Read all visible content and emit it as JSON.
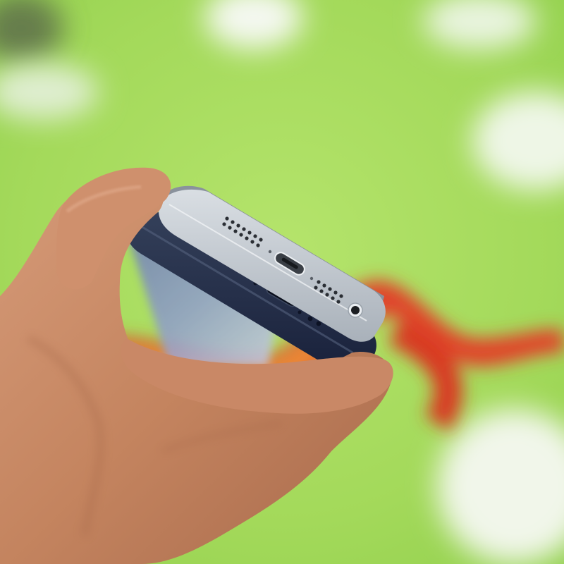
{
  "scene": {
    "subject": "two-phones-bottom-edges",
    "background": "blurred-green-backdrop",
    "colors": {
      "background_green": "#a6dc5a",
      "background_light": "#d8f0b0",
      "silver_phone": "#c9cfd6",
      "dark_phone": "#26324a",
      "skin": "#c98a6a",
      "accent_red": "#e0452a",
      "accent_orange": "#f2a03a"
    },
    "objects": [
      "hand",
      "silver-phone",
      "dark-blue-phone",
      "speaker-grille",
      "charging-port",
      "headphone-jack",
      "blurred-red-ribbon",
      "blurred-white-objects"
    ]
  }
}
